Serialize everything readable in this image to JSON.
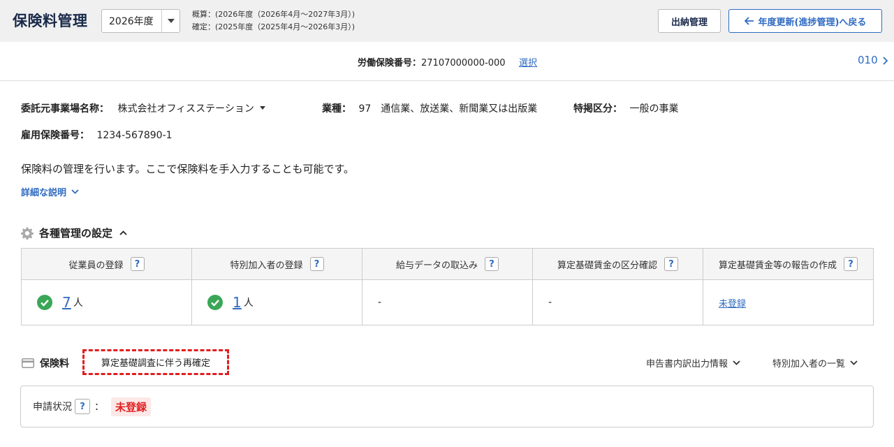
{
  "header": {
    "title": "保険料管理",
    "year_select": "2026年度",
    "period_estimate": "概算：(2026年度（2026年4月～2027年3月）)",
    "period_confirmed": "確定：(2025年度（2025年4月～2026年3月）)",
    "cash_button": "出納管理",
    "back_button": "年度更新(進捗管理)へ戻る"
  },
  "insurance_bar": {
    "label": "労働保険番号：",
    "number": "27107000000-000",
    "select_link": "選択",
    "code": "010"
  },
  "company": {
    "client_label": "委託元事業場名称：",
    "client_value": "株式会社オフィスステーション",
    "industry_label": "業種：",
    "industry_value": "97　通信業、放送業、新聞業又は出版業",
    "category_label": "特掲区分：",
    "category_value": "一般の事業",
    "employment_label": "雇用保険番号：",
    "employment_value": "1234-567890-1"
  },
  "description": "保険料の管理を行います。ここで保険料を手入力することも可能です。",
  "detail_link": "詳細な説明",
  "settings": {
    "title": "各種管理の設定",
    "columns": [
      {
        "header": "従業員の登録",
        "count": "7",
        "unit": "人"
      },
      {
        "header": "特別加入者の登録",
        "count": "1",
        "unit": "人"
      },
      {
        "header": "給与データの取込み",
        "value": "-"
      },
      {
        "header": "算定基礎賃金の区分確認",
        "value": "-"
      },
      {
        "header": "算定基礎賃金等の報告の作成",
        "link": "未登録"
      }
    ],
    "help": "?"
  },
  "premium": {
    "title": "保険料",
    "highlight_label": "算定基礎調査に伴う再確定",
    "output_link": "申告書内訳出力情報",
    "special_list_link": "特別加入者の一覧",
    "status_label": "申請状況",
    "status_sep": "：",
    "status_value": "未登録"
  },
  "colors": {
    "accent": "#2f6bc2",
    "alert": "#e01e1e",
    "success": "#3aa757"
  }
}
